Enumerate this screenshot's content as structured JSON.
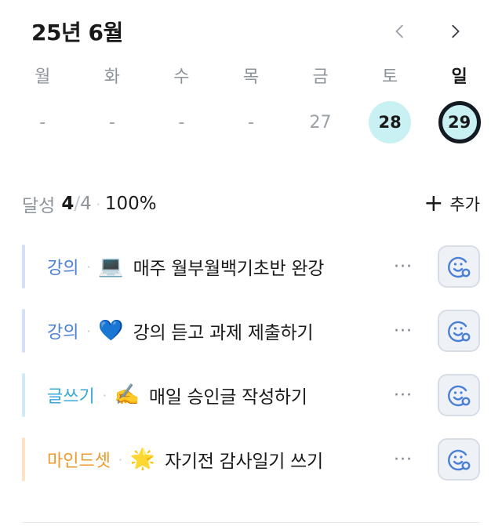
{
  "header": {
    "title": "25년 6월",
    "prev_icon": "chevron-left-icon",
    "next_icon": "chevron-right-icon"
  },
  "calendar": {
    "weekdays": [
      {
        "label": "월"
      },
      {
        "label": "화"
      },
      {
        "label": "수"
      },
      {
        "label": "목"
      },
      {
        "label": "금"
      },
      {
        "label": "토"
      },
      {
        "label": "일"
      }
    ],
    "dates": [
      {
        "label": "-"
      },
      {
        "label": "-"
      },
      {
        "label": "-"
      },
      {
        "label": "-"
      },
      {
        "label": "27"
      },
      {
        "label": "28"
      },
      {
        "label": "29"
      }
    ],
    "highlight_color": "#c9f1f3",
    "today_border_color": "#141a22"
  },
  "summary": {
    "label": "달성",
    "done": "4",
    "separator": "/",
    "total": "4",
    "dot": "·",
    "percent": "100%"
  },
  "add_button": {
    "plus": "+",
    "label": "추가"
  },
  "tasks": [
    {
      "category": "강의",
      "dot": "·",
      "emoji": "💻",
      "title": "매주 월부월백기초반 완강",
      "more": "···",
      "category_color": "#4a7fd6",
      "bar_color": "#d4e0f6",
      "react_icon": "smiley-add-icon"
    },
    {
      "category": "강의",
      "dot": "·",
      "emoji": "💙",
      "title": "강의 듣고 과제 제출하기",
      "more": "···",
      "category_color": "#4a7fd6",
      "bar_color": "#d4e0f6",
      "react_icon": "smiley-add-icon"
    },
    {
      "category": "글쓰기",
      "dot": "·",
      "emoji": "✍️",
      "title": "매일 승인글 작성하기",
      "more": "···",
      "category_color": "#36a9d8",
      "bar_color": "#cdeaf6",
      "react_icon": "smiley-add-icon"
    },
    {
      "category": "마인드셋",
      "dot": "·",
      "emoji": "🌟",
      "title": "자기전 감사일기 쓰기",
      "more": "···",
      "category_color": "#ee9a2d",
      "bar_color": "#fde3c4",
      "react_icon": "smiley-add-icon"
    }
  ]
}
